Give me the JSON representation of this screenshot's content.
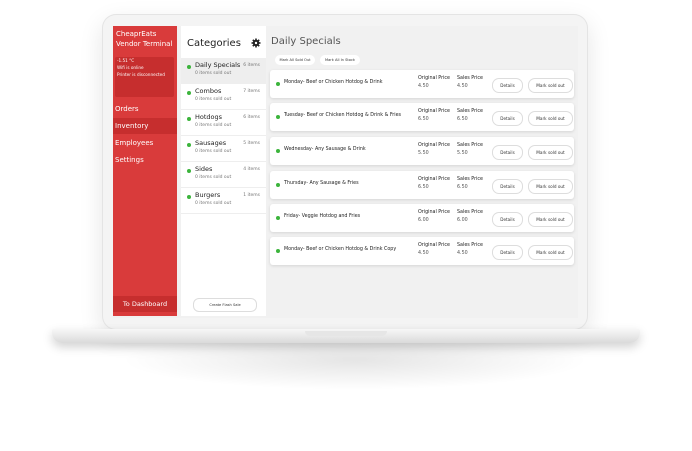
{
  "sidebar": {
    "brand": "CheaprEats Vendor Terminal",
    "status": {
      "temp": "-1.51 °C",
      "wifi": "Wifi is online",
      "printer": "Printer is disconnected"
    },
    "nav": [
      {
        "label": "Orders",
        "active": false
      },
      {
        "label": "Inventory",
        "active": true
      },
      {
        "label": "Employees",
        "active": false
      },
      {
        "label": "Settings",
        "active": false
      }
    ],
    "dashboard": "To Dashboard"
  },
  "categories": {
    "title": "Categories",
    "items": [
      {
        "name": "Daily Specials",
        "sub": "0 items sold out",
        "count": "6 items"
      },
      {
        "name": "Combos",
        "sub": "0 items sold out",
        "count": "7 items"
      },
      {
        "name": "Hotdogs",
        "sub": "0 items sold out",
        "count": "6 items"
      },
      {
        "name": "Sausages",
        "sub": "0 items sold out",
        "count": "5 items"
      },
      {
        "name": "Sides",
        "sub": "0 items sold out",
        "count": "4 items"
      },
      {
        "name": "Burgers",
        "sub": "0 items sold out",
        "count": "1 items"
      }
    ],
    "flash": "Create Flash Sale"
  },
  "main": {
    "title": "Daily Specials",
    "mark_all_out": "Mark All Sold Out",
    "mark_all_in": "Mark All In Stock",
    "orig_label": "Original Price",
    "sale_label": "Sales Price",
    "details": "Details",
    "mark": "Mark sold out",
    "items": [
      {
        "name": "Monday- Beef or Chicken Hotdog & Drink",
        "orig": "4.50",
        "sale": "4.50"
      },
      {
        "name": "Tuesday- Beef or Chicken Hotdog & Drink & Fries",
        "orig": "6.50",
        "sale": "6.50"
      },
      {
        "name": "Wednesday- Any Sausage & Drink",
        "orig": "5.50",
        "sale": "5.50"
      },
      {
        "name": "Thursday- Any Sausage & Fries",
        "orig": "6.50",
        "sale": "6.50"
      },
      {
        "name": "Friday- Veggie Hotdog and Fries",
        "orig": "6.00",
        "sale": "6.00"
      },
      {
        "name": "Monday- Beef or Chicken Hotdog & Drink Copy",
        "orig": "4.50",
        "sale": "4.50"
      }
    ]
  },
  "colors": {
    "accent": "#d93b3b",
    "accent_dark": "#c62e2e",
    "status_green": "#3cb43c"
  }
}
